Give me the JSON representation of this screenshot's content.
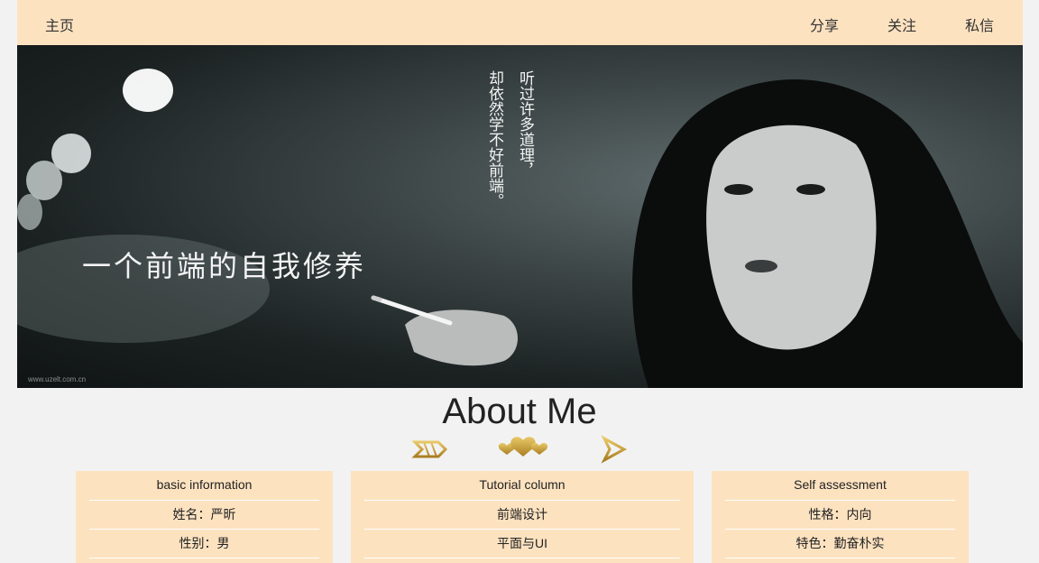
{
  "nav": {
    "home": "主页",
    "share": "分享",
    "follow": "关注",
    "message": "私信"
  },
  "banner": {
    "title": "一个前端的自我修养",
    "poem_line1": "听过许多道理，",
    "poem_line2": "却依然学不好前端。",
    "watermark": "www.uzelt.com.cn"
  },
  "about": {
    "title": "About Me"
  },
  "cards": [
    {
      "header": "basic information",
      "rows": [
        "姓名：严昕",
        "性别：男"
      ]
    },
    {
      "header": "Tutorial column",
      "rows": [
        "前端设计",
        "平面与UI"
      ]
    },
    {
      "header": "Self assessment",
      "rows": [
        "性格：内向",
        "特色：勤奋朴实"
      ]
    }
  ],
  "colors": {
    "nav_bg": "#fde2c0",
    "page_bg": "#f2f2f2",
    "card_bg": "#fde2c0",
    "divider_gold": "#c9a23a"
  }
}
